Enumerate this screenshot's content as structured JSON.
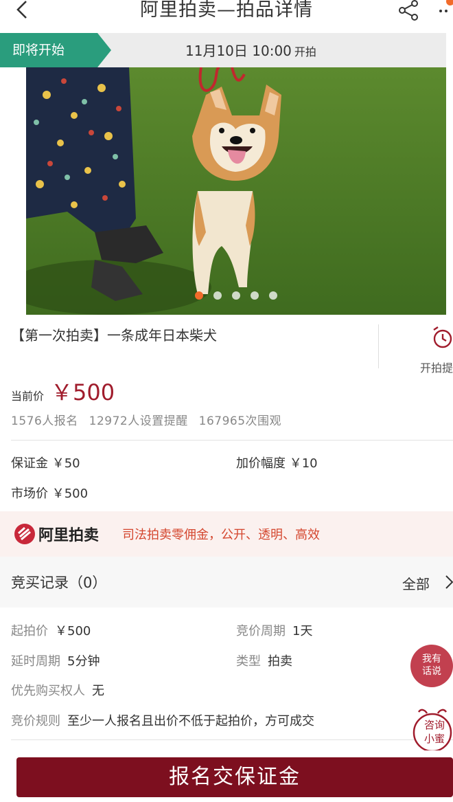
{
  "header": {
    "title": "阿里拍卖—拍品详情",
    "icons": {
      "back": "chevron-left-icon",
      "share": "share-icon",
      "more": "more-icon"
    }
  },
  "hero": {
    "status_tag": "即将开始",
    "start_time": "11月10日 10:00",
    "start_suffix": "开拍",
    "carousel_count": 5,
    "carousel_active": 1,
    "tag_color": "#2a9d7d"
  },
  "product": {
    "title": "【第一次拍卖】一条成年日本柴犬",
    "remind_label": "开拍提醒"
  },
  "price": {
    "label": "当前价",
    "value": "￥500",
    "color": "#a01c2c"
  },
  "stats": "1576人报名 12972人设置提醒 167965次围观",
  "terms": {
    "deposit": "保证金 ￥50",
    "increment": "加价幅度 ￥10",
    "market_price": "市场价 ￥500"
  },
  "banner": {
    "brand": "阿里拍卖",
    "slogan": "司法拍卖零佣金，公开、透明、高效"
  },
  "record": {
    "label": "竞买记录（0）",
    "all": "全部"
  },
  "rules": {
    "start_price_key": "起拍价",
    "start_price_val": "￥500",
    "cycle_key": "竞价周期",
    "cycle_val": "1天",
    "delay_key": "延时周期",
    "delay_val": "5分钟",
    "type_key": "类型",
    "type_val": "拍卖",
    "priority_key": "优先购买权人",
    "priority_val": "无",
    "rule_key": "竞价规则",
    "rule_val": "至少一人报名且出价不低于起拍价，方可成交"
  },
  "floating": {
    "talk": "我有话说",
    "consult": "咨询小蜜"
  },
  "cta": "报名交保证金"
}
